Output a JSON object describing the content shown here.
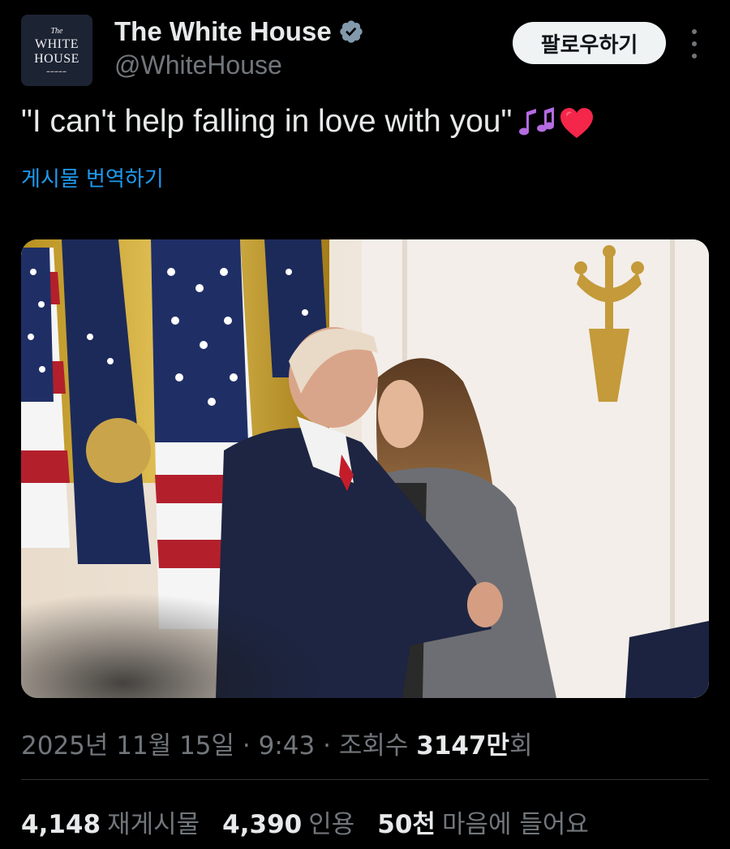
{
  "account": {
    "avatar_line1": "The",
    "avatar_line2": "WHITE",
    "avatar_line3": "HOUSE",
    "display_name": "The White House",
    "handle": "@WhiteHouse",
    "verified_icon": "verified-badge-icon",
    "follow_label": "팔로우하기"
  },
  "post": {
    "text": "\"I can't help falling in love with you\"",
    "emojis": [
      "musical-notes-icon",
      "red-heart-icon"
    ],
    "translate_label": "게시물 번역하기",
    "image_alt": "photo"
  },
  "meta": {
    "date": "2025년 11월 15일",
    "time": "9:43",
    "views_label": "조회수",
    "views_value": "3147만",
    "views_suffix": "회"
  },
  "stats": {
    "reposts_value": "4,148",
    "reposts_label": "재게시물",
    "quotes_value": "4,390",
    "quotes_label": "인용",
    "likes_value": "50천",
    "likes_label": "마음에 들어요"
  },
  "colors": {
    "background": "#000000",
    "link": "#1d9bf0",
    "muted": "#71767b",
    "verified": "#829aab"
  }
}
